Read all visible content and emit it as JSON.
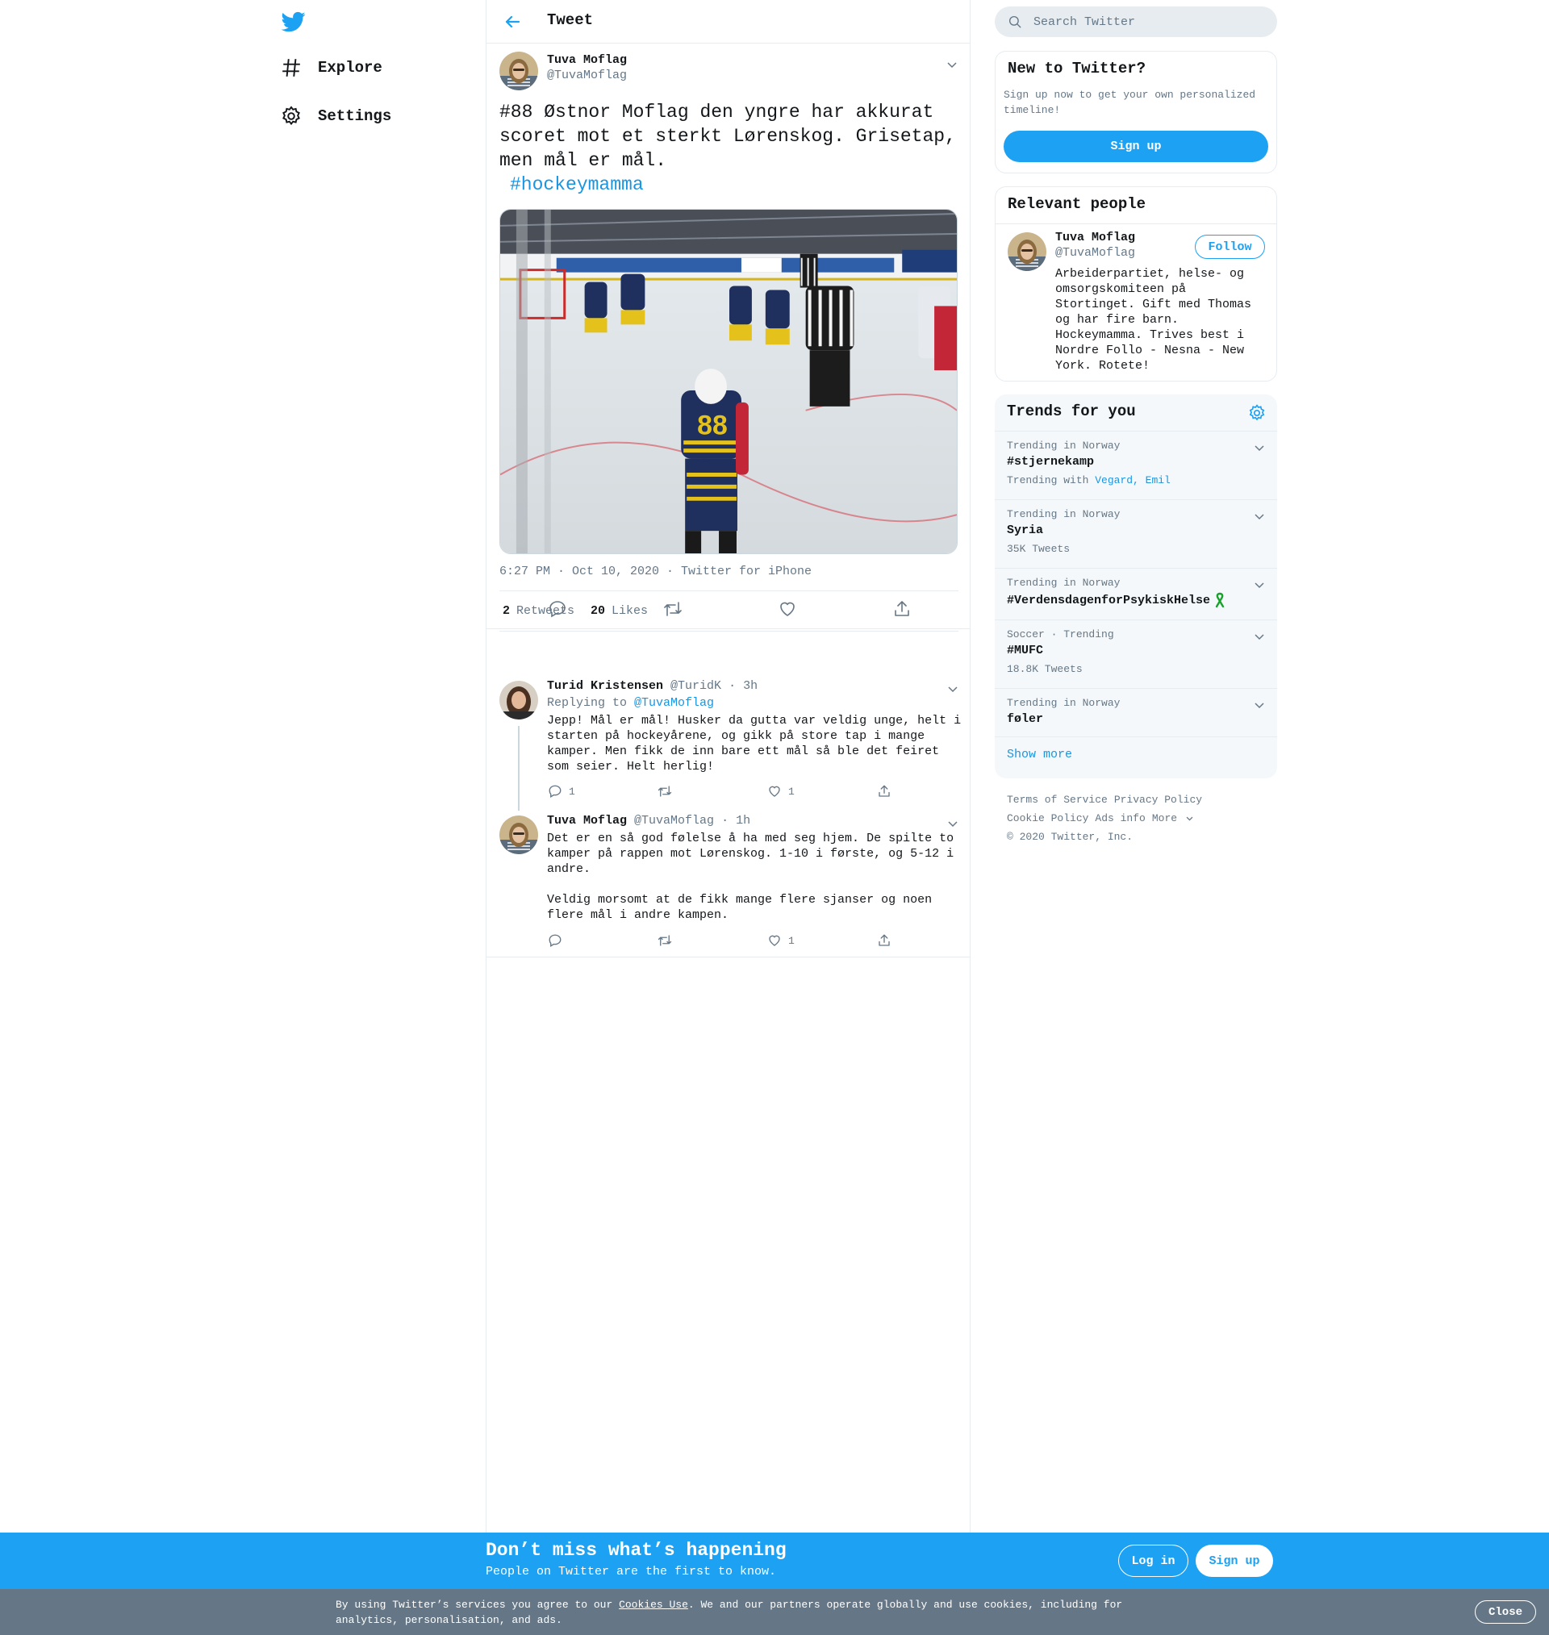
{
  "nav": {
    "explore_label": "Explore",
    "settings_label": "Settings"
  },
  "header": {
    "title": "Tweet"
  },
  "main_tweet": {
    "name": "Tuva Moflag",
    "handle": "@TuvaMoflag",
    "text": "#88 Østnor Moflag den yngre har akkurat scoret mot et sterkt Lørenskog. Grisetap, men mål er mål.",
    "hashtag": "#hockeymamma",
    "meta": "6:27 PM · Oct 10, 2020 · Twitter for iPhone",
    "retweets_count": "2",
    "retweets_label": "Retweets",
    "likes_count": "20",
    "likes_label": "Likes"
  },
  "replies": [
    {
      "name": "Turid Kristensen",
      "handle": "@TuridK",
      "time": "· 3h",
      "replying_prefix": "Replying to",
      "replying_to": "@TuvaMoflag",
      "text": "Jepp! Mål er mål! Husker da gutta var veldig unge, helt i starten på hockeyårene, og gikk på store tap i mange kamper. Men fikk de inn bare ett mål så ble det feiret som seier. Helt herlig!",
      "reply_count": "1",
      "like_count": "1"
    },
    {
      "name": "Tuva Moflag",
      "handle": "@TuvaMoflag",
      "time": "· 1h",
      "text": "Det er en så god følelse å ha med seg hjem. De spilte to kamper på rappen mot Lørenskog. 1-10 i første, og 5-12 i andre.\n\nVeldig morsomt at de fikk mange flere sjanser og noen flere mål i andre kampen.",
      "like_count": "1"
    }
  ],
  "search": {
    "placeholder": "Search Twitter"
  },
  "new_to_twitter": {
    "title": "New to Twitter?",
    "description": "Sign up now to get your own personalized timeline!",
    "signup_label": "Sign up"
  },
  "relevant_people": {
    "title": "Relevant people",
    "name": "Tuva Moflag",
    "handle": "@TuvaMoflag",
    "follow_label": "Follow",
    "bio": "Arbeiderpartiet, helse- og omsorgskomiteen på Stortinget. Gift med Thomas og har fire barn. Hockeymamma. Trives best i Nordre Follo - Nesna - New York. Rotete!"
  },
  "trends": {
    "title": "Trends for you",
    "items": [
      {
        "context": "Trending in Norway",
        "name": "#stjernekamp",
        "sub_prefix": "Trending with",
        "sub_links": "Vegard, Emil"
      },
      {
        "context": "Trending in Norway",
        "name": "Syria",
        "sub": "35K Tweets"
      },
      {
        "context": "Trending in Norway",
        "name": "#VerdensdagenforPsykiskHelse"
      },
      {
        "context": "Soccer · Trending",
        "name": "#MUFC",
        "sub": "18.8K Tweets"
      },
      {
        "context": "Trending in Norway",
        "name": "føler"
      }
    ],
    "show_more": "Show more"
  },
  "footer": {
    "terms": "Terms of Service",
    "privacy": "Privacy Policy",
    "cookie": "Cookie Policy",
    "ads": "Ads info",
    "more": "More",
    "copyright": "© 2020 Twitter, Inc."
  },
  "signup_bar": {
    "title": "Don’t miss what’s happening",
    "subtitle": "People on Twitter are the first to know.",
    "login_label": "Log in",
    "signup_label": "Sign up"
  },
  "cookie_bar": {
    "text_before": "By using Twitter’s services you agree to our ",
    "link": "Cookies Use",
    "text_after": ". We and our partners operate globally and use cookies, including for analytics, personalisation, and ads.",
    "close_label": "Close"
  },
  "colors": {
    "brand": "#1da1f2",
    "link": "#1b95e0",
    "muted": "#657786",
    "border": "#e6ecf0"
  },
  "icons": [
    "twitter-logo-icon",
    "hashtag-icon",
    "gear-icon",
    "back-arrow-icon",
    "chevron-down-icon",
    "reply-icon",
    "retweet-icon",
    "like-icon",
    "share-icon",
    "search-icon",
    "ribbon-icon"
  ]
}
